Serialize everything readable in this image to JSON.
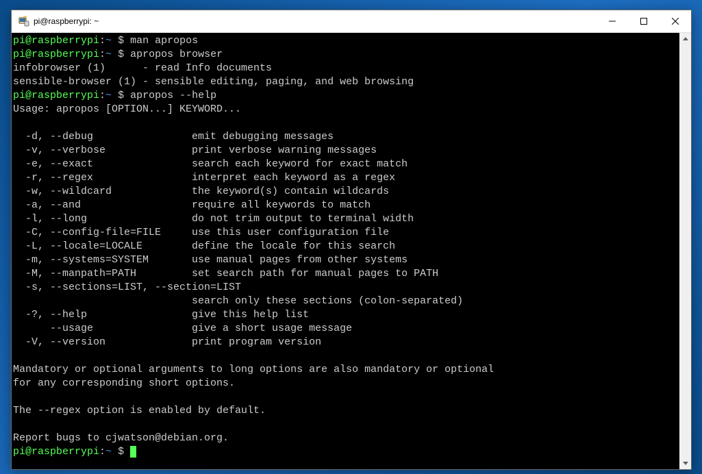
{
  "window": {
    "title": "pi@raspberrypi: ~"
  },
  "prompt": {
    "user_host": "pi@raspberrypi",
    "colon": ":",
    "path": "~",
    "dollar": " $ "
  },
  "lines": {
    "cmd1": "man apropos",
    "cmd2": "apropos browser",
    "out_l1": "infobrowser (1)      - read Info documents",
    "out_l2": "sensible-browser (1) - sensible editing, paging, and web browsing",
    "cmd3": "apropos --help",
    "out_l3": "Usage: apropos [OPTION...] KEYWORD...",
    "out_l4": "",
    "out_l5": "  -d, --debug                emit debugging messages",
    "out_l6": "  -v, --verbose              print verbose warning messages",
    "out_l7": "  -e, --exact                search each keyword for exact match",
    "out_l8": "  -r, --regex                interpret each keyword as a regex",
    "out_l9": "  -w, --wildcard             the keyword(s) contain wildcards",
    "out_l10": "  -a, --and                  require all keywords to match",
    "out_l11": "  -l, --long                 do not trim output to terminal width",
    "out_l12": "  -C, --config-file=FILE     use this user configuration file",
    "out_l13": "  -L, --locale=LOCALE        define the locale for this search",
    "out_l14": "  -m, --systems=SYSTEM       use manual pages from other systems",
    "out_l15": "  -M, --manpath=PATH         set search path for manual pages to PATH",
    "out_l16": "  -s, --sections=LIST, --section=LIST",
    "out_l17": "                             search only these sections (colon-separated)",
    "out_l18": "  -?, --help                 give this help list",
    "out_l19": "      --usage                give a short usage message",
    "out_l20": "  -V, --version              print program version",
    "out_l21": "",
    "out_l22": "Mandatory or optional arguments to long options are also mandatory or optional",
    "out_l23": "for any corresponding short options.",
    "out_l24": "",
    "out_l25": "The --regex option is enabled by default.",
    "out_l26": "",
    "out_l27": "Report bugs to cjwatson@debian.org."
  },
  "colors": {
    "prompt_green": "#55ff55",
    "prompt_blue": "#5294e2",
    "fg": "#cccccc",
    "bg": "#000000",
    "desktop": "#1e6fc4"
  }
}
